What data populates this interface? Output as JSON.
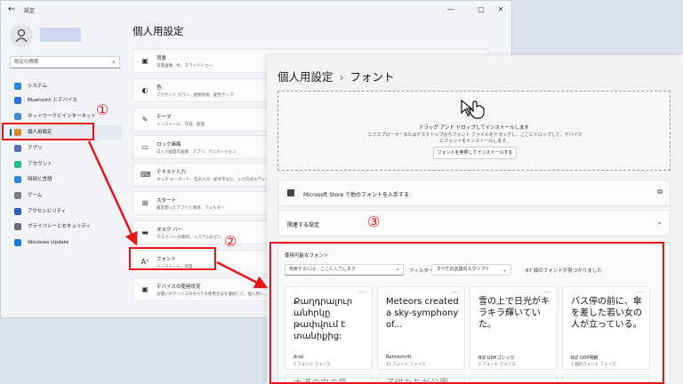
{
  "window": {
    "back_arrow": "←",
    "title": "設定",
    "minimize": "—",
    "maximize": "▢",
    "close": "✕"
  },
  "sidebar": {
    "search_placeholder": "設定の検索",
    "items": [
      {
        "label": "システム",
        "icon_color": "#2b88d8"
      },
      {
        "label": "Bluetooth とデバイス",
        "icon_color": "#2b6fd8"
      },
      {
        "label": "ネットワークとインターネット",
        "icon_color": "#3a8ad8"
      },
      {
        "label": "個人用設定",
        "icon_color": "#d88a2b"
      },
      {
        "label": "アプリ",
        "icon_color": "#5a6fb8"
      },
      {
        "label": "アカウント",
        "icon_color": "#2bb88a"
      },
      {
        "label": "時刻と言語",
        "icon_color": "#2b88d8"
      },
      {
        "label": "ゲーム",
        "icon_color": "#7a7a8a"
      },
      {
        "label": "アクセシビリティ",
        "icon_color": "#2b5fb8"
      },
      {
        "label": "プライバシーとセキュリティ",
        "icon_color": "#6a6a7a"
      },
      {
        "label": "Windows Update",
        "icon_color": "#1a7ad8"
      }
    ]
  },
  "personalization": {
    "title": "個人用設定",
    "cards": [
      {
        "title": "背景",
        "sub": "背景画像、色、スライドショー"
      },
      {
        "title": "色",
        "sub": "アクセント カラー、透明効果、配色テーマ"
      },
      {
        "title": "テーマ",
        "sub": "インストール、作成、管理"
      },
      {
        "title": "ロック画面",
        "sub": "ロック画面の画像、アプリ、アニメーション"
      },
      {
        "title": "テキスト入力",
        "sub": "タッチ キーボード、音声入力、絵文字など、入力方式エディター"
      },
      {
        "title": "スタート",
        "sub": "最近使ったアプリと項目、フォルダー"
      },
      {
        "title": "タスク バー",
        "sub": "タスク バーの動作、システムのピン"
      },
      {
        "title": "フォント",
        "sub": "インストール、管理"
      },
      {
        "title": "デバイスの使用状況",
        "sub": "お使いのデバイスのすべての使用方法を選択して、個人用に..."
      }
    ]
  },
  "fonts_page": {
    "breadcrumb_parent": "個人用設定",
    "breadcrumb_sep": "›",
    "breadcrumb_current": "フォント",
    "drop_title": "ドラッグ アンド ドロップしてインストールします",
    "drop_desc": "エクスプローラーまたはデスクトップからフォント ファイルをドラッグし、ここにドロップして、デバイスにフォントをインストールします。",
    "browse_button": "フォントを参照してインストールする",
    "store_link": "Microsoft Store で他のフォントを入手する",
    "related": "関連する設定",
    "available_title": "使用可能なフォント",
    "search_placeholder": "検索するには、ここに入力します",
    "filter_label": "フィルター:",
    "filter_value": "すべての言語のスクリプト",
    "found_count": "87 個のフォントが見つかりました",
    "cards": [
      {
        "sample": "Քաղդրալուր անհրկը թափվում է տանիքից:",
        "name": "Arial",
        "faces": "5 フォント フェイス"
      },
      {
        "sample": "Meteors created a sky-symphony of...",
        "name": "Bahnschrift",
        "faces": "15 フォント フェイス"
      },
      {
        "sample": "雪の上で日光がキラキラ輝いていた。",
        "name": "BIZ UDPゴシック",
        "faces": "2 フォント フェイス"
      },
      {
        "sample": "バス停の前に、傘を差した若い女の人が立っている。",
        "name": "BIZ UDP明朝",
        "faces": "1 個のフォント フェイス"
      }
    ],
    "partial_cards": [
      "大道の中の音",
      "子供たちが公園",
      "",
      ""
    ]
  },
  "annotations": {
    "n1": "①",
    "n2": "②",
    "n3": "③",
    "color": "#e8141b"
  }
}
